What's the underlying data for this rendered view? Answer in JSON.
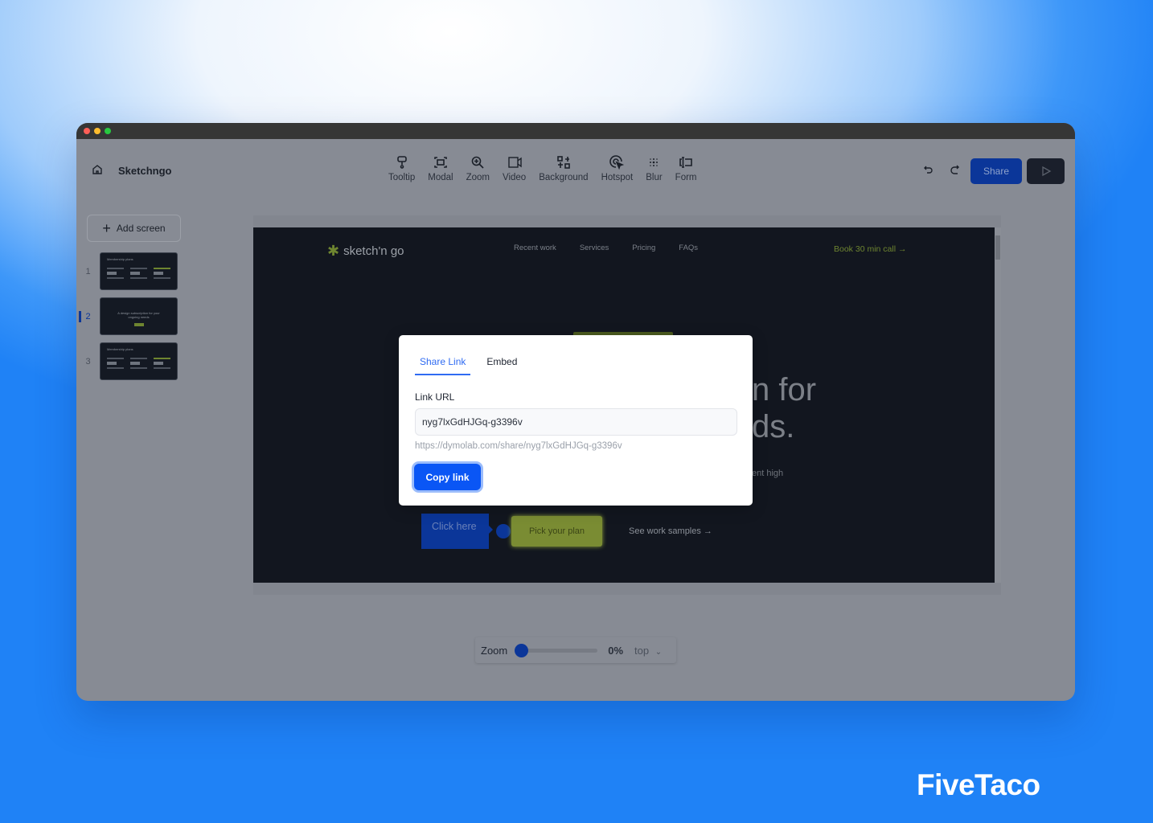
{
  "app": {
    "project_name": "Sketchngo"
  },
  "toolbar": {
    "items": [
      {
        "label": "Tooltip",
        "icon": "tooltip-icon"
      },
      {
        "label": "Modal",
        "icon": "modal-icon"
      },
      {
        "label": "Zoom",
        "icon": "zoom-icon"
      },
      {
        "label": "Video",
        "icon": "video-icon"
      },
      {
        "label": "Background",
        "icon": "background-icon"
      },
      {
        "label": "Hotspot",
        "icon": "hotspot-icon"
      },
      {
        "label": "Blur",
        "icon": "blur-icon"
      },
      {
        "label": "Form",
        "icon": "form-icon"
      }
    ],
    "share_label": "Share"
  },
  "sidebar": {
    "add_screen_label": "Add screen",
    "screens": [
      {
        "number": "1",
        "title": "Membership plans"
      },
      {
        "number": "2",
        "title": "A design subscription for your ongoing needs",
        "active": true
      },
      {
        "number": "3",
        "title": "Membership plans"
      }
    ]
  },
  "canvas": {
    "logo": "sketch'n go",
    "nav": [
      "Recent work",
      "Services",
      "Pricing",
      "FAQs"
    ],
    "cta": "Book 30 min call",
    "hero_line1": "n for",
    "hero_line2": "ds.",
    "hero_sub": "ent high",
    "tooltip_label": "Click here",
    "primary_btn": "Pick your plan",
    "secondary_link": "See work samples"
  },
  "zoom": {
    "label": "Zoom",
    "value": "0%",
    "percent": 0,
    "position": "top"
  },
  "modal": {
    "tabs": [
      "Share Link",
      "Embed"
    ],
    "active_tab": "Share Link",
    "link_label": "Link URL",
    "link_value": "nyg7lxGdHJGq-g3396v",
    "full_url": "https://dymolab.com/share/nyg7lxGdHJGq-g3396v",
    "copy_label": "Copy link"
  },
  "brand": "FiveTaco",
  "colors": {
    "accent": "#0a56f5",
    "brand_green": "#8ea23a"
  }
}
